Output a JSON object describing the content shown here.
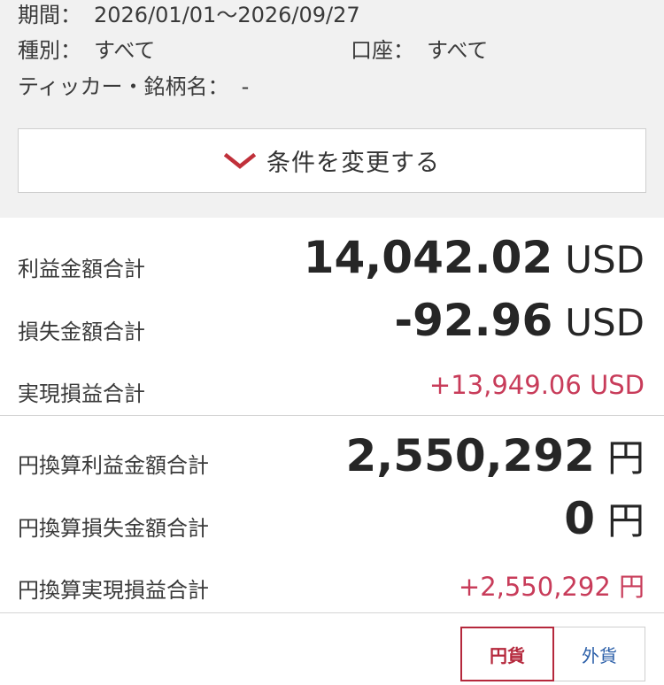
{
  "filters": {
    "period_label": "期間：",
    "period_value": "2026/01/01〜2026/09/27",
    "type_label": "種別：",
    "type_value": "すべて",
    "account_label": "口座：",
    "account_value": "すべて",
    "ticker_label": "ティッカー・銘柄名：",
    "ticker_value": "-"
  },
  "change_button": {
    "label": "条件を変更する",
    "icon": "chevron-down-icon",
    "icon_color": "#c0303a"
  },
  "usd": {
    "profit_label": "利益金額合計",
    "profit_value": "14,042.02",
    "profit_unit": "USD",
    "loss_label": "損失金額合計",
    "loss_value": "-92.96",
    "loss_unit": "USD",
    "realized_label": "実現損益合計",
    "realized_value": "+13,949.06 USD"
  },
  "jpy": {
    "profit_label": "円換算利益金額合計",
    "profit_value": "2,550,292",
    "profit_unit": "円",
    "loss_label": "円換算損失金額合計",
    "loss_value": "0",
    "loss_unit": "円",
    "realized_label": "円換算実現損益合計",
    "realized_value": "+2,550,292 円"
  },
  "currency_toggle": {
    "jpy_label": "円貨",
    "fx_label": "外貨",
    "selected": "円貨"
  },
  "colors": {
    "positive": "#c83c5a",
    "accent": "#b5283c",
    "link": "#2a5ea8"
  }
}
